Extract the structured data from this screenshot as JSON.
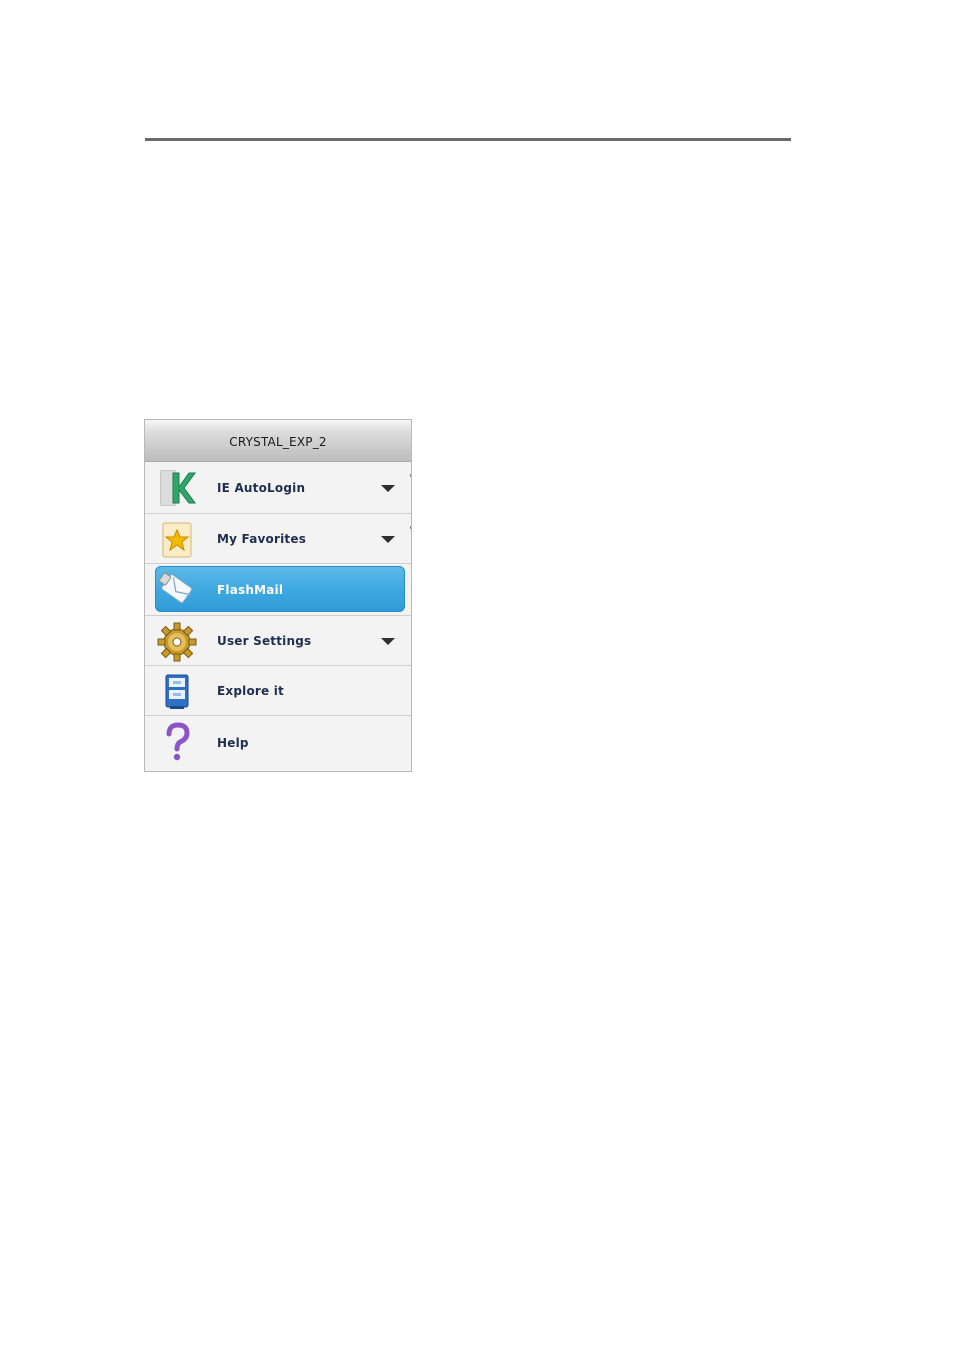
{
  "menu": {
    "title": "CRYSTAL_EXP_2",
    "items": [
      {
        "label": "IE AutoLogin",
        "icon": "ie-autologin-icon",
        "has_submenu": true
      },
      {
        "label": "My Favorites",
        "icon": "favorites-star-icon",
        "has_submenu": true
      },
      {
        "label": "FlashMail",
        "icon": "flashmail-icon",
        "has_submenu": false,
        "active": true
      },
      {
        "label": "User Settings",
        "icon": "gear-icon",
        "has_submenu": true
      },
      {
        "label": "Explore it",
        "icon": "explore-drive-icon",
        "has_submenu": false
      },
      {
        "label": "Help",
        "icon": "help-question-icon",
        "has_submenu": false
      }
    ]
  },
  "colors": {
    "active_item": "#3fa9e0",
    "label_text": "#1f2f4f",
    "header_bg": "#cfcfcf",
    "top_rule": "#6b6b6b"
  }
}
